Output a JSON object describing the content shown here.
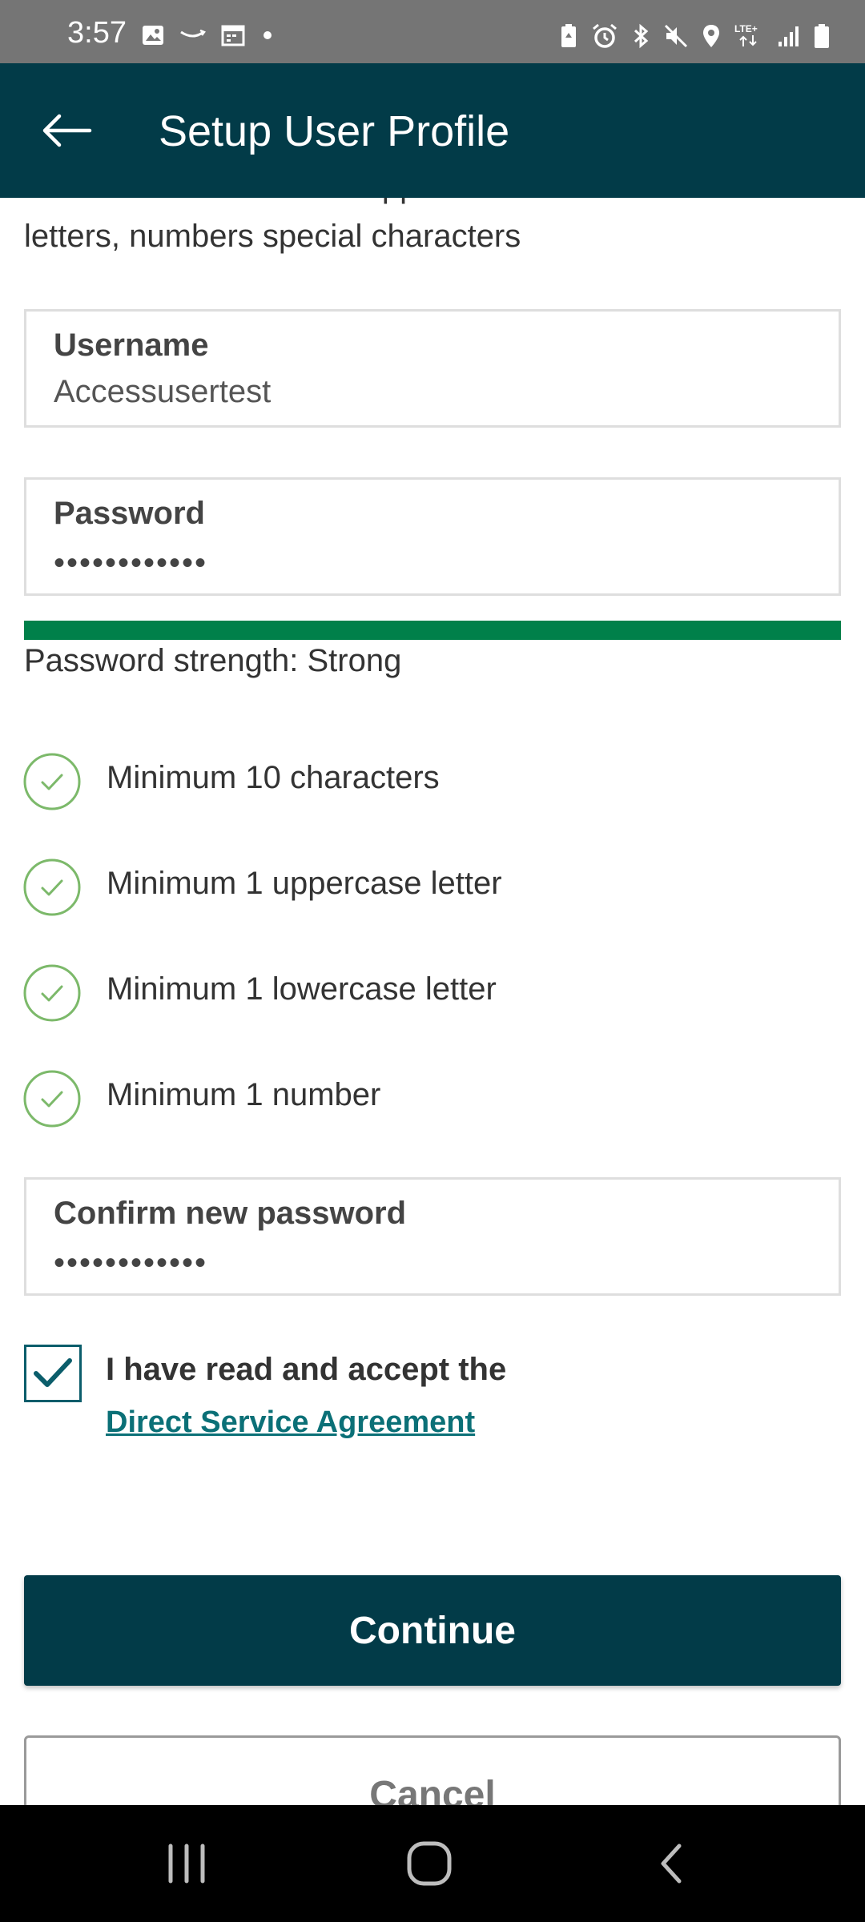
{
  "status_bar": {
    "time": "3:57",
    "left_icons": [
      "image-icon",
      "amazon-icon",
      "calendar-icon",
      "dot-icon"
    ],
    "right_icons": [
      "battery-saver-icon",
      "alarm-icon",
      "bluetooth-icon",
      "mute-icon",
      "location-icon",
      "lte-icon",
      "signal-icon",
      "battery-icon"
    ],
    "network_label": "LTE+"
  },
  "app_bar": {
    "title": "Setup User Profile"
  },
  "intro": {
    "partial_line": "Password must contain upper and lower case",
    "text": "letters, numbers special characters"
  },
  "form": {
    "username": {
      "label": "Username",
      "value": "Accessusertest"
    },
    "password": {
      "label": "Password",
      "masked_value": "••••••••••••"
    },
    "strength": {
      "text": "Password strength: Strong",
      "fraction": 1.0,
      "color": "#00804a"
    },
    "requirements": [
      {
        "label": "Minimum 10 characters",
        "met": true
      },
      {
        "label": "Minimum 1 uppercase letter",
        "met": true
      },
      {
        "label": "Minimum 1 lowercase letter",
        "met": true
      },
      {
        "label": "Minimum 1 number",
        "met": true
      }
    ],
    "confirm_password": {
      "label": "Confirm new password",
      "masked_value": "••••••••••••"
    },
    "agreement": {
      "checked": true,
      "text": "I have read and accept the",
      "link_text": "Direct Service Agreement"
    }
  },
  "buttons": {
    "continue": "Continue",
    "cancel": "Cancel"
  },
  "colors": {
    "primary": "#023b48",
    "success": "#00804a",
    "check_green": "#7cb96a",
    "link": "#0b7077"
  }
}
